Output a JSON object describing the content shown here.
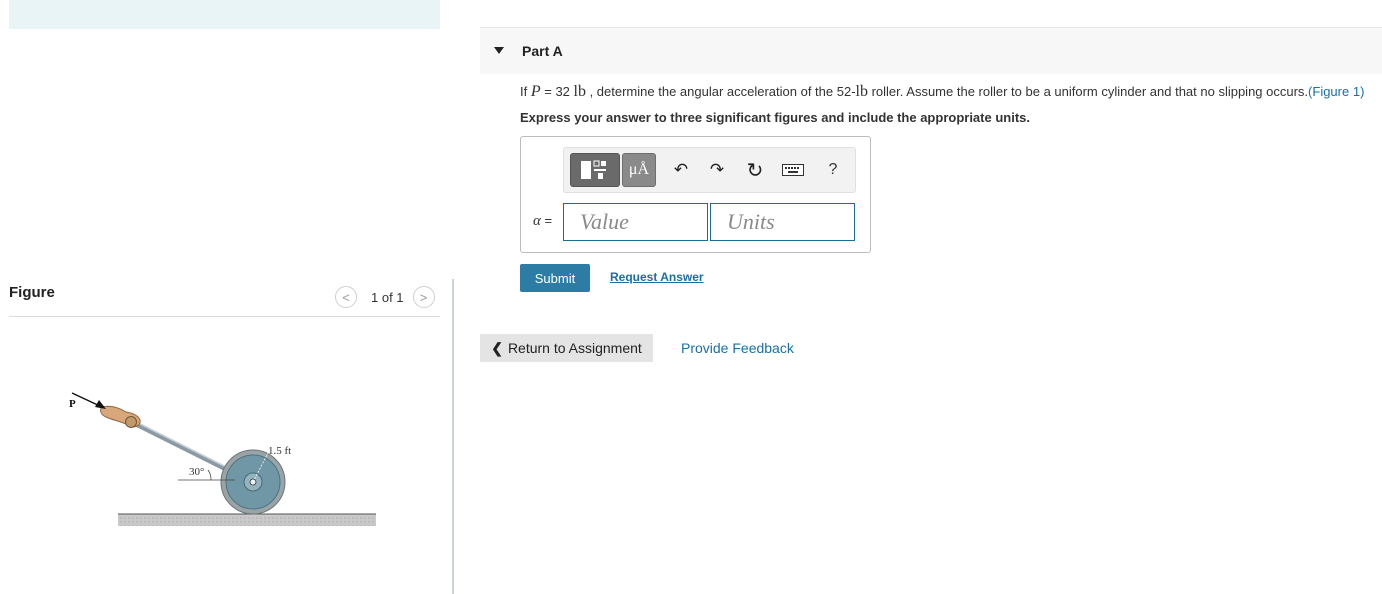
{
  "figure_panel": {
    "title": "Figure",
    "pager_text": "1 of 1",
    "figure": {
      "force_label": "P",
      "angle_label": "30°",
      "radius_label": "1.5 ft"
    }
  },
  "part": {
    "title": "Part A",
    "problem": {
      "prefix": "If ",
      "var_P": "P",
      "eq": " = 32 ",
      "unit_lb": "lb",
      "mid": " , determine the angular acceleration of the 52-",
      "unit_lb2": "lb",
      "suffix": " roller. Assume the roller to be a uniform cylinder and that no slipping occurs.",
      "figure_link": "(Figure 1)"
    },
    "instruction": "Express your answer to three significant figures and include the appropriate units.",
    "toolbar": {
      "units_label": "μÅ",
      "undo_icon": "↶",
      "redo_icon": "↷",
      "reset_icon": "↻",
      "help_label": "?"
    },
    "answer": {
      "var": "α",
      "eq": " =",
      "value_placeholder": "Value",
      "units_placeholder": "Units"
    },
    "submit_label": "Submit",
    "request_answer_label": "Request Answer"
  },
  "footer": {
    "return_label": "Return to Assignment",
    "feedback_label": "Provide Feedback"
  }
}
